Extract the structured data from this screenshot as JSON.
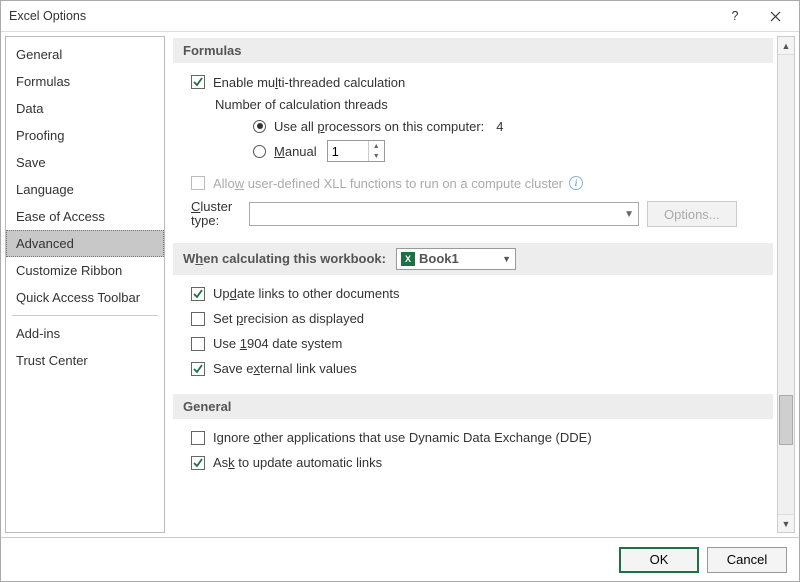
{
  "window": {
    "title": "Excel Options"
  },
  "sidebar": {
    "items": [
      {
        "label": "General"
      },
      {
        "label": "Formulas"
      },
      {
        "label": "Data"
      },
      {
        "label": "Proofing"
      },
      {
        "label": "Save"
      },
      {
        "label": "Language"
      },
      {
        "label": "Ease of Access"
      },
      {
        "label": "Advanced"
      },
      {
        "label": "Customize Ribbon"
      },
      {
        "label": "Quick Access Toolbar"
      },
      {
        "label": "Add-ins"
      },
      {
        "label": "Trust Center"
      }
    ]
  },
  "formulas": {
    "section_title": "Formulas",
    "enable_mt_pre": "Enable mu",
    "enable_mt_u": "l",
    "enable_mt_post": "ti-threaded calculation",
    "threads_label": "Number of calculation threads",
    "use_all_pre": "Use all ",
    "use_all_u": "p",
    "use_all_post": "rocessors on this computer:",
    "processor_count": "4",
    "manual_u": "M",
    "manual_post": "anual",
    "manual_value": "1",
    "allow_xll_pre": "Allo",
    "allow_xll_u": "w",
    "allow_xll_post": " user-defined XLL functions to run on a compute cluster",
    "cluster_type_label": "Cluster type:",
    "options_btn": "Options..."
  },
  "calc_wb": {
    "section_pre": "W",
    "section_u": "h",
    "section_post": "en calculating this workbook:",
    "workbook": "Book1",
    "update_links_pre": "Up",
    "update_links_u": "d",
    "update_links_post": "ate links to other documents",
    "precision_pre": "Set ",
    "precision_u": "p",
    "precision_post": "recision as displayed",
    "date1904_pre": "Use ",
    "date1904_u": "1",
    "date1904_post": "904 date system",
    "save_ext_pre": "Save e",
    "save_ext_u": "x",
    "save_ext_post": "ternal link values"
  },
  "general": {
    "section_title": "General",
    "ignore_dde_pre": "Ignore ",
    "ignore_dde_u": "o",
    "ignore_dde_post": "ther applications that use Dynamic Data Exchange (DDE)",
    "ask_update_pre": "As",
    "ask_update_u": "k",
    "ask_update_post": " to update automatic links"
  },
  "footer": {
    "ok": "OK",
    "cancel": "Cancel"
  }
}
